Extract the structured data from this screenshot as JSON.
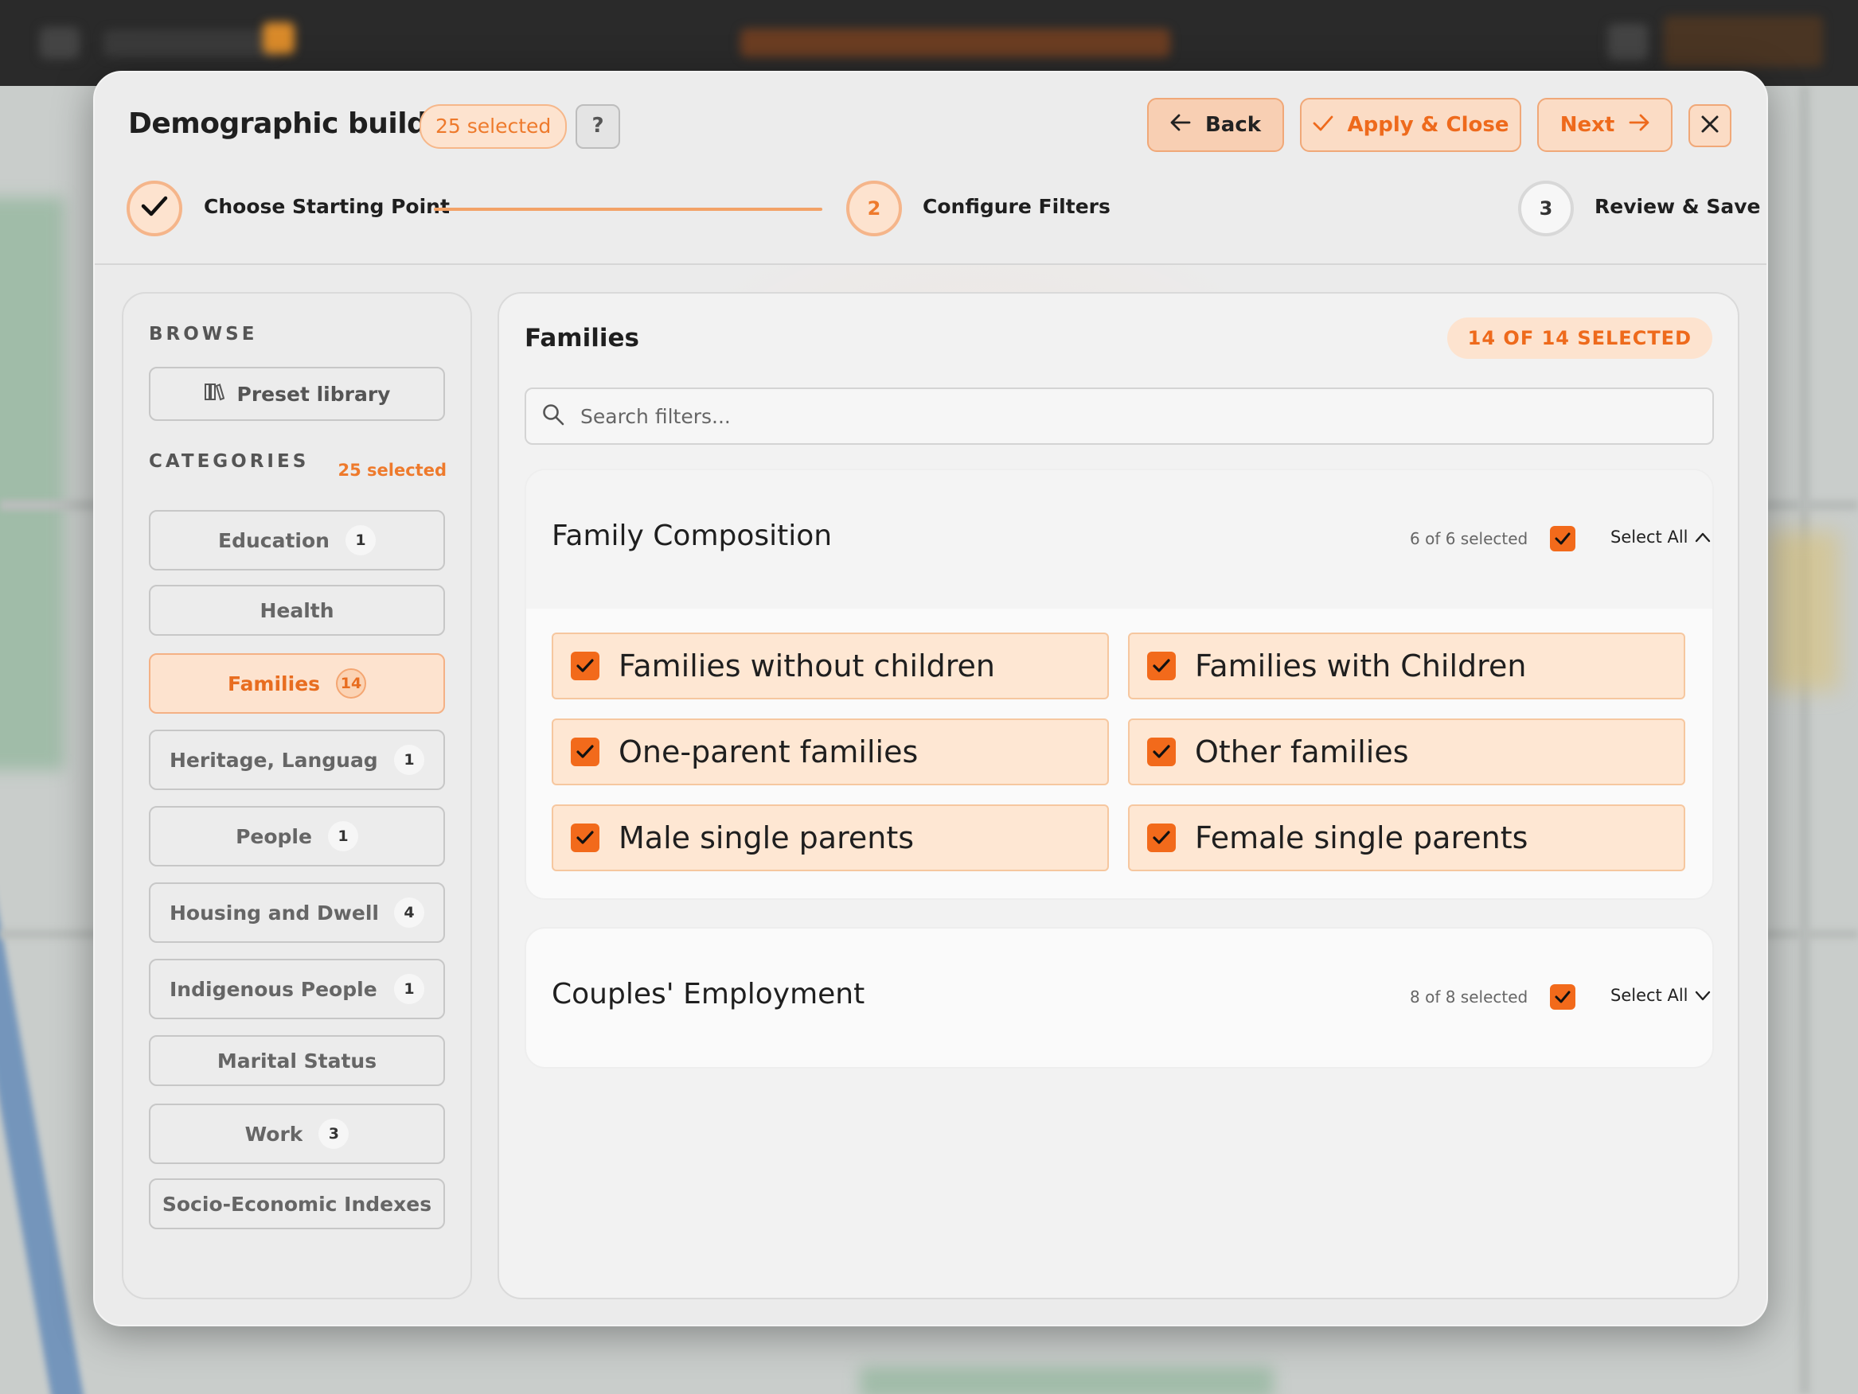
{
  "modal": {
    "title": "Demographic builder",
    "selected_pill": "25 selected",
    "help_label": "?",
    "buttons": {
      "back": "Back",
      "apply": "Apply & Close",
      "next": "Next"
    }
  },
  "steps": [
    {
      "number": "",
      "label": "Choose Starting Point",
      "state": "done"
    },
    {
      "number": "2",
      "label": "Configure Filters",
      "state": "current"
    },
    {
      "number": "3",
      "label": "Review & Save",
      "state": "upcoming"
    }
  ],
  "sidebar": {
    "browse_heading": "BROWSE",
    "preset_label": "Preset library",
    "categories_heading": "CATEGORIES",
    "categories_selected": "25 selected",
    "categories": [
      {
        "label": "Education",
        "count": "1"
      },
      {
        "label": "Health",
        "count": ""
      },
      {
        "label": "Families",
        "count": "14"
      },
      {
        "label": "Heritage, Language an",
        "count": "1"
      },
      {
        "label": "People",
        "count": "1"
      },
      {
        "label": "Housing and Dwellings",
        "count": "4"
      },
      {
        "label": "Indigenous People's De",
        "count": "1"
      },
      {
        "label": "Marital Status",
        "count": ""
      },
      {
        "label": "Work",
        "count": "3"
      },
      {
        "label": "Socio-Economic Indexes",
        "count": ""
      }
    ]
  },
  "main": {
    "title": "Families",
    "selected_pill": "14 OF 14 SELECTED",
    "search": {
      "placeholder": "Search filters...",
      "value": ""
    },
    "groups": [
      {
        "title": "Family Composition",
        "meta": "6 of 6 selected",
        "select_all": "Select All",
        "expanded": true,
        "options": [
          "Families without children",
          "Families with Children",
          "One-parent families",
          "Other families",
          "Male single parents",
          "Female single parents"
        ]
      },
      {
        "title": "Couples' Employment",
        "meta": "8 of 8 selected",
        "select_all": "Select All",
        "expanded": false
      }
    ]
  },
  "colors": {
    "accent": "#f26a1b",
    "accent_soft": "#fde3cf",
    "panel": "#ebebeb"
  }
}
